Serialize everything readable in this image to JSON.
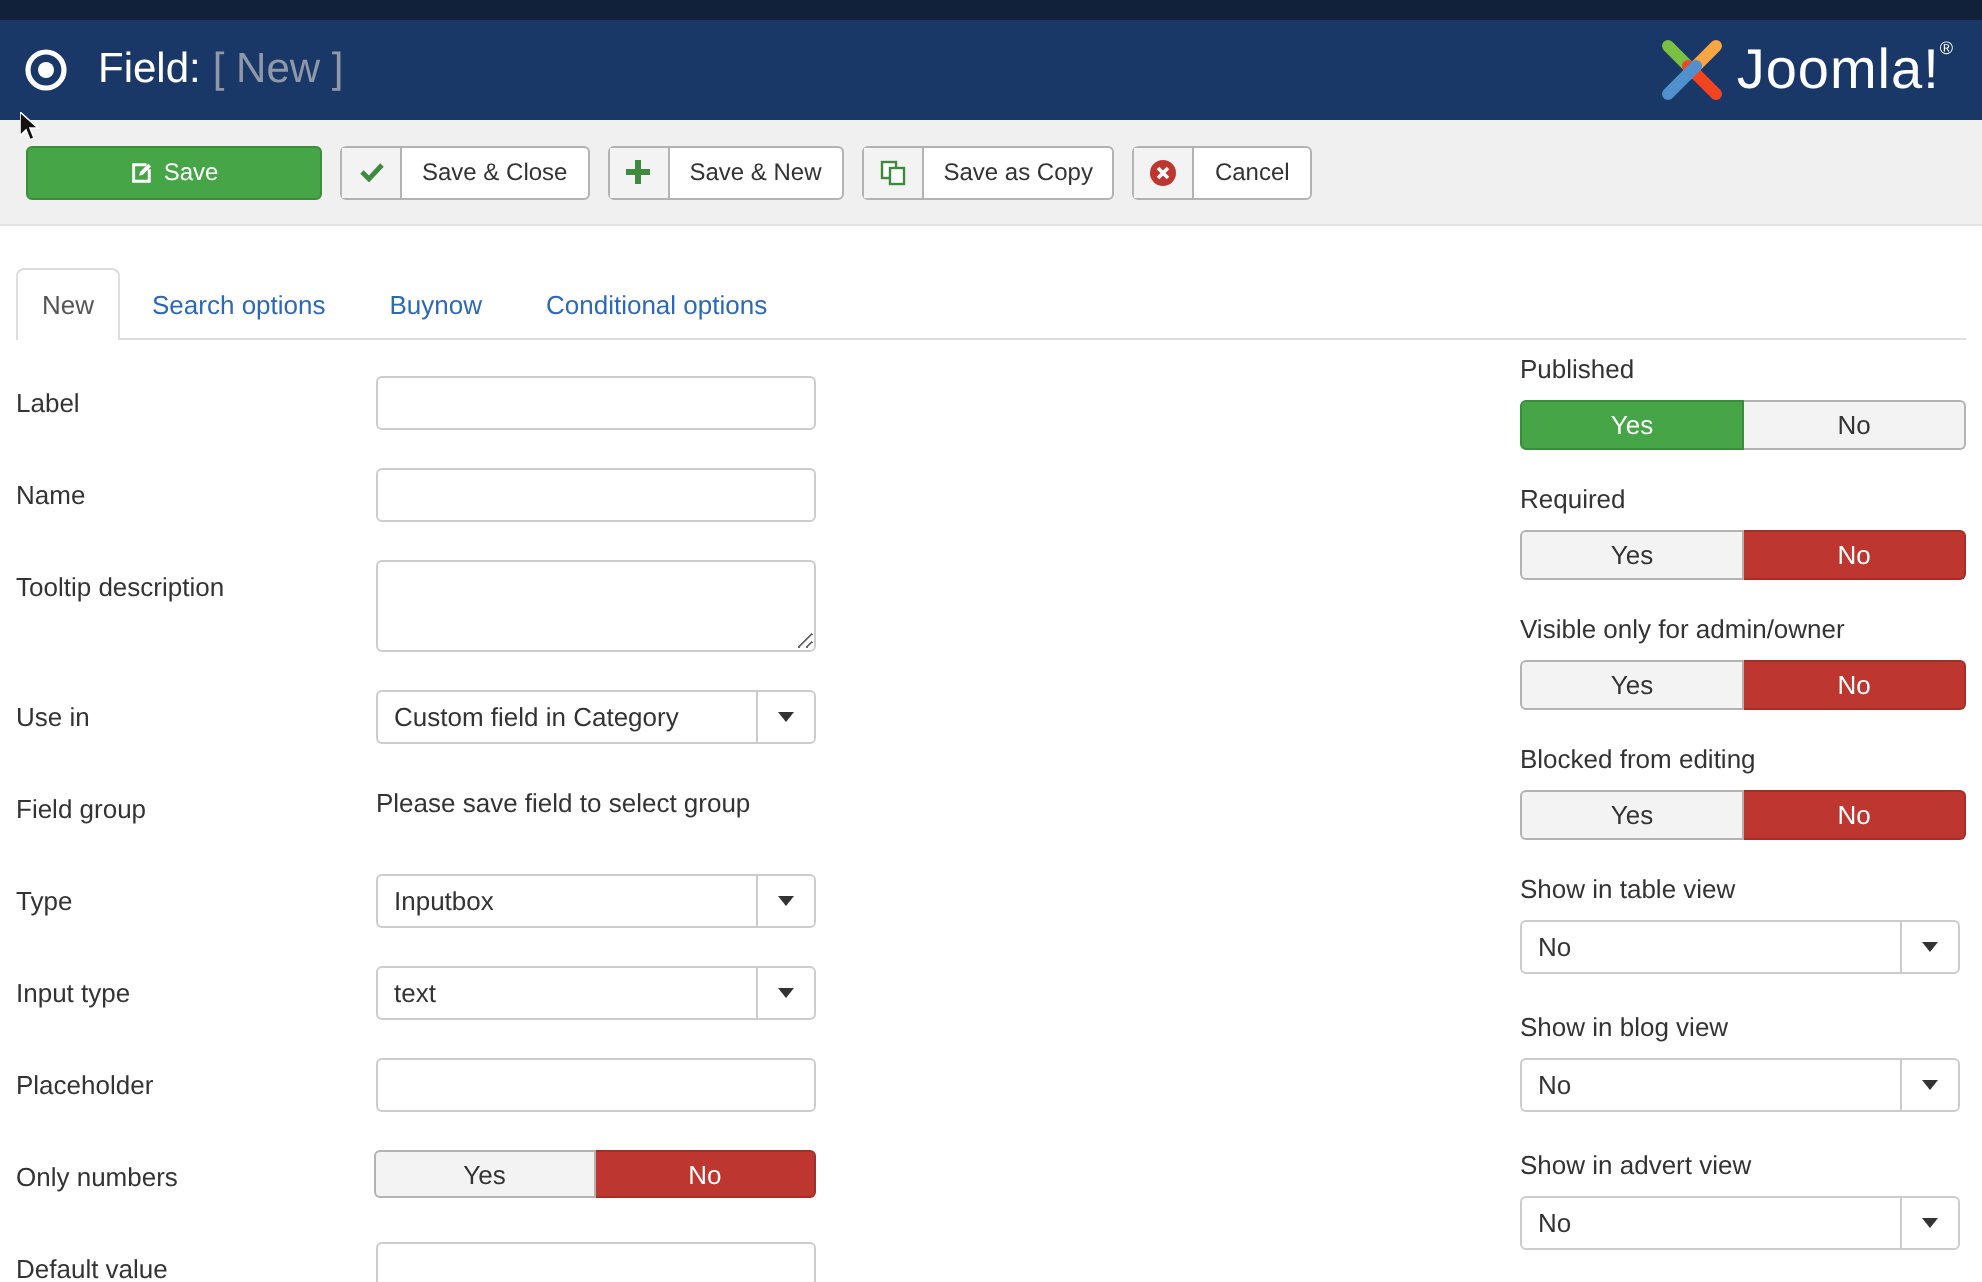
{
  "header": {
    "title": "Field:",
    "subtitle": "[ New ]",
    "logo_text": "Joomla!$^{®}$"
  },
  "toolbar": [
    {
      "label": "Save",
      "kind": "save"
    },
    {
      "label": "Save & Close",
      "kind": "close"
    },
    {
      "label": "Save & New",
      "kind": "new"
    },
    {
      "label": "Save as Copy",
      "kind": "copy"
    },
    {
      "label": "Cancel",
      "kind": "cancel"
    }
  ],
  "tabs": [
    {
      "label": "New",
      "selected": true
    },
    {
      "label": "Search options",
      "selected": false
    },
    {
      "label": "Buynow",
      "selected": false
    },
    {
      "label": "Conditional options",
      "selected": false
    }
  ],
  "left_fields": [
    {
      "label": "Label",
      "kind": "text"
    },
    {
      "label": "Name",
      "kind": "text"
    },
    {
      "label": "Tooltip description",
      "kind": "textarea"
    },
    {
      "label": "Use in",
      "kind": "select",
      "value": "Custom field in Category"
    },
    {
      "label": "Field group",
      "kind": "static",
      "value": "Please save field to select group"
    },
    {
      "label": "Type",
      "kind": "select",
      "value": "Inputbox"
    },
    {
      "label": "Input type",
      "kind": "select",
      "value": "text"
    },
    {
      "label": "Placeholder",
      "kind": "text"
    },
    {
      "label": "Only numbers",
      "kind": "toggle",
      "options": [
        {
          "label": "Yes",
          "selected": false
        },
        {
          "label": "No",
          "selected": true
        }
      ]
    },
    {
      "label": "Default value",
      "kind": "text"
    }
  ],
  "right_fields": [
    {
      "label": "Published",
      "kind": "toggle",
      "options": [
        {
          "label": "Yes",
          "selected": true
        },
        {
          "label": "No",
          "selected": false
        }
      ]
    },
    {
      "label": "Required",
      "kind": "toggle",
      "options": [
        {
          "label": "Yes",
          "selected": false
        },
        {
          "label": "No",
          "selected": true
        }
      ]
    },
    {
      "label": "Visible only for admin/owner",
      "kind": "toggle",
      "options": [
        {
          "label": "Yes",
          "selected": false
        },
        {
          "label": "No",
          "selected": true
        }
      ]
    },
    {
      "label": "Blocked from editing",
      "kind": "toggle",
      "options": [
        {
          "label": "Yes",
          "selected": false
        },
        {
          "label": "No",
          "selected": true
        }
      ]
    },
    {
      "label": "Show in table view",
      "kind": "select",
      "value": "No"
    },
    {
      "label": "Show in blog view",
      "kind": "select",
      "value": "No"
    },
    {
      "label": "Show in advert view",
      "kind": "select",
      "value": "No"
    }
  ]
}
